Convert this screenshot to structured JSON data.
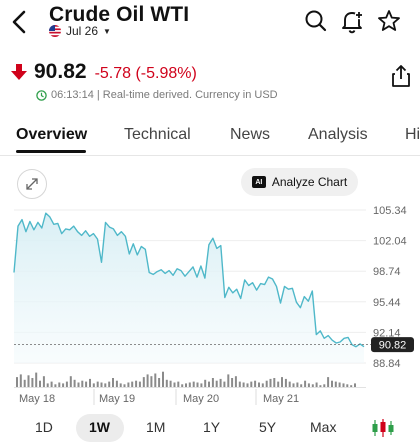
{
  "header": {
    "title": "Crude Oil WTI",
    "subtitle_date": "Jul 26"
  },
  "quote": {
    "price": "90.82",
    "change": "-5.78 (-5.98%)",
    "realtime_note": "06:13:14 | Real-time derived. Currency in USD",
    "direction_color": "#d0021b"
  },
  "tabs": [
    "Overview",
    "Technical",
    "News",
    "Analysis",
    "Hi"
  ],
  "active_tab": "Overview",
  "actions": {
    "analyze_label": "Analyze Chart"
  },
  "ranges": [
    "1D",
    "1W",
    "1M",
    "1Y",
    "5Y",
    "Max"
  ],
  "active_range": "1W",
  "icons": [
    "back-arrow-icon",
    "us-flag-icon",
    "search-icon",
    "bell-plus-icon",
    "star-icon",
    "arrow-down-icon",
    "share-icon",
    "clock-icon",
    "expand-icon",
    "ai-icon",
    "candlestick-icon"
  ],
  "chart_data": {
    "type": "area",
    "y_ticks": [
      "105.34",
      "102.04",
      "98.74",
      "95.44",
      "92.14",
      "88.84"
    ],
    "current_value_label": "90.82",
    "current_value": 90.82,
    "x_ticks": [
      "May 18",
      "May 19",
      "May 20",
      "May 21"
    ],
    "line_color": "#4fb8c9",
    "fill_color": "#e6f4f8",
    "grid": true,
    "ylim": [
      88.84,
      105.34
    ],
    "series_values": [
      98.6,
      103.6,
      104.3,
      103.0,
      104.1,
      103.2,
      104.0,
      103.4,
      105.0,
      104.6,
      103.8,
      103.9,
      102.8,
      103.3,
      103.2,
      103.6,
      103.0,
      102.6,
      103.1,
      102.5,
      102.8,
      102.2,
      99.7,
      104.0,
      103.5,
      103.3,
      102.6,
      103.0,
      102.5,
      100.6,
      101.7,
      100.5,
      101.4,
      101.1,
      98.6,
      98.4,
      98.7,
      98.9,
      98.5,
      98.8,
      98.3,
      99.0,
      98.8,
      98.2,
      98.7,
      99.2,
      98.1,
      99.3,
      98.0,
      101.6,
      102.3,
      101.2,
      101.5,
      95.9,
      97.0,
      96.4,
      96.8,
      95.8,
      97.8,
      97.2,
      97.5,
      96.7,
      97.4,
      97.3,
      98.1,
      97.9,
      97.1,
      95.3,
      97.1,
      96.8,
      96.9,
      95.4,
      94.8,
      96.0,
      95.5,
      96.6,
      91.9,
      92.3,
      91.5,
      91.8,
      91.3,
      91.0,
      91.1,
      91.5,
      91.6,
      90.8,
      90.6,
      90.9,
      90.6
    ],
    "volume_values": [
      0.55,
      0.7,
      0.4,
      0.65,
      0.5,
      0.8,
      0.35,
      0.6,
      0.2,
      0.3,
      0.15,
      0.25,
      0.2,
      0.3,
      0.6,
      0.4,
      0.25,
      0.35,
      0.3,
      0.45,
      0.2,
      0.3,
      0.25,
      0.2,
      0.3,
      0.5,
      0.35,
      0.2,
      0.15,
      0.25,
      0.3,
      0.35,
      0.3,
      0.55,
      0.7,
      0.6,
      0.75,
      0.5,
      0.85,
      0.4,
      0.35,
      0.25,
      0.3,
      0.15,
      0.2,
      0.25,
      0.3,
      0.25,
      0.2,
      0.4,
      0.3,
      0.5,
      0.35,
      0.45,
      0.3,
      0.7,
      0.5,
      0.6,
      0.3,
      0.25,
      0.2,
      0.3,
      0.35,
      0.25,
      0.2,
      0.35,
      0.45,
      0.5,
      0.3,
      0.55,
      0.45,
      0.3,
      0.2,
      0.25,
      0.15,
      0.35,
      0.2,
      0.15,
      0.25,
      0.1,
      0.15,
      0.55,
      0.35,
      0.3,
      0.25,
      0.2,
      0.15,
      0.1,
      0.2
    ]
  }
}
